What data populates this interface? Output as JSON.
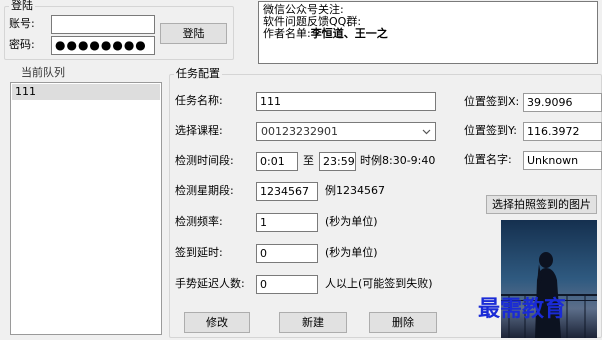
{
  "login": {
    "group_title": "登陆",
    "account_label": "账号:",
    "account_value": "",
    "password_label": "密码:",
    "password_mask": "●●●●●●●●",
    "login_button": "登陆"
  },
  "notes": {
    "line1": "微信公众号关注:",
    "line2": "软件问题反馈QQ群:",
    "line3_prefix": "作者名单:",
    "line3_names": "李恒道、王一之"
  },
  "queue": {
    "title": "当前队列",
    "items": [
      "111"
    ]
  },
  "task": {
    "title": "任务配置",
    "name_label": "任务名称:",
    "name_value": "111",
    "course_label": "选择课程:",
    "course_value": "00123232901",
    "time_label": "检测时间段:",
    "time_start": "0:01",
    "time_to": "至",
    "time_end": "23:59",
    "time_example": "时例8:30-9:40",
    "week_label": "检测星期段:",
    "week_value": "1234567",
    "week_example": "例1234567",
    "freq_label": "检测频率:",
    "freq_value": "1",
    "freq_unit": "(秒为单位)",
    "delay_label": "签到延时:",
    "delay_value": "0",
    "delay_unit": "(秒为单位)",
    "gesture_label": "手势延迟人数:",
    "gesture_value": "0",
    "gesture_unit": "人以上(可能签到失败)",
    "loc_x_label": "位置签到X:",
    "loc_x_value": "39.9096",
    "loc_y_label": "位置签到Y:",
    "loc_y_value": "116.3972",
    "loc_name_label": "位置名字:",
    "loc_name_value": "Unknown",
    "choose_photo_button": "选择拍照签到的图片",
    "edit_button": "修改",
    "new_button": "新建",
    "delete_button": "删除"
  },
  "watermark": "最需教育",
  "colors": {
    "background": "#f0f0f0",
    "input_border": "#7a7a7a",
    "button_face": "#e1e1e1",
    "selected_row": "#dddddd",
    "watermark_blue": "#1a2bd6"
  }
}
